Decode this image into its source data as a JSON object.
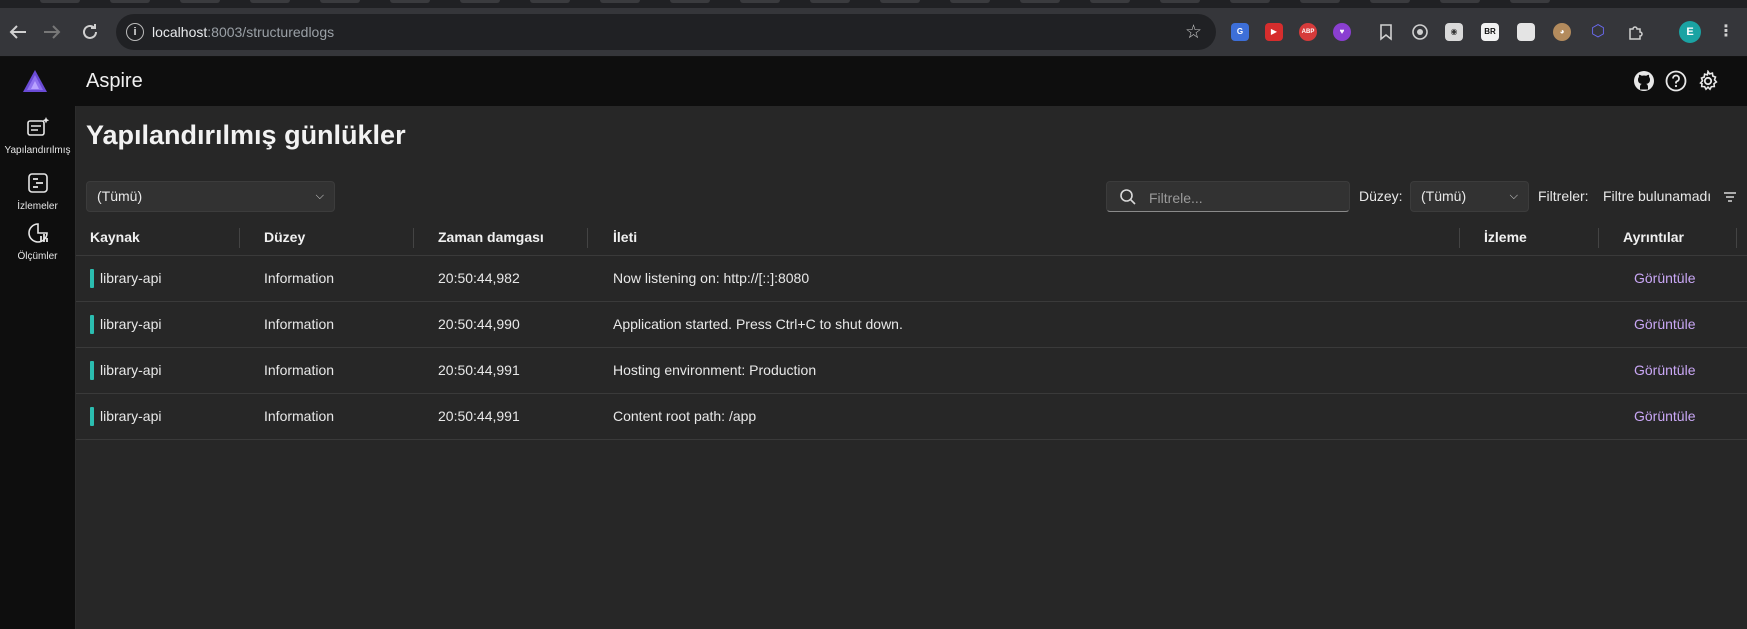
{
  "browser": {
    "url_host": "localhost",
    "url_rest": ":8003/structuredlogs",
    "extensions": [
      {
        "name": "translate-ext-icon",
        "label": "G",
        "color": "#3d6fd8"
      },
      {
        "name": "video-ext-icon",
        "label": "▶",
        "color": "#d62d2d"
      },
      {
        "name": "adblock-ext-icon",
        "label": "ABP",
        "color": "#d63b3b"
      },
      {
        "name": "heart-ext-icon",
        "label": "♥",
        "color": "#8a3fd1"
      },
      {
        "name": "bookmark-ext-icon",
        "label": "",
        "color": "transparent"
      },
      {
        "name": "record-ext-icon",
        "label": "◎",
        "color": "transparent"
      },
      {
        "name": "camera-ext-icon",
        "label": "◉",
        "color": "#d9d9d9"
      },
      {
        "name": "br-ext-icon",
        "label": "BR",
        "color": "#f2f2f2"
      },
      {
        "name": "note-ext-icon",
        "label": "",
        "color": "#e4e4e4"
      },
      {
        "name": "glasses-ext-icon",
        "label": "◕",
        "color": "#b38b5d"
      },
      {
        "name": "cube-ext-icon",
        "label": "⬡",
        "color": "#4a4ae0"
      },
      {
        "name": "puzzle-ext-icon",
        "label": "",
        "color": "transparent"
      }
    ],
    "profile_initial": "E"
  },
  "app": {
    "title": "Aspire"
  },
  "sidebar": {
    "items": [
      {
        "label": "Yapılandırılmış"
      },
      {
        "label": "İzlemeler"
      },
      {
        "label": "Ölçümler"
      }
    ]
  },
  "page": {
    "title": "Yapılandırılmış günlükler",
    "resource_select": "(Tümü)",
    "search_placeholder": "Filtrele...",
    "level_label": "Düzey:",
    "level_select": "(Tümü)",
    "filters_label": "Filtreler:",
    "filters_value": "Filtre bulunamadı"
  },
  "grid": {
    "headers": [
      "Kaynak",
      "Düzey",
      "Zaman damgası",
      "İleti",
      "İzleme",
      "Ayrıntılar"
    ],
    "rows": [
      {
        "source": "library-api",
        "level": "Information",
        "timestamp": "20:50:44,982",
        "message": "Now listening on: http://[::]:8080",
        "trace": "",
        "details": "Görüntüle"
      },
      {
        "source": "library-api",
        "level": "Information",
        "timestamp": "20:50:44,990",
        "message": "Application started. Press Ctrl+C to shut down.",
        "trace": "",
        "details": "Görüntüle"
      },
      {
        "source": "library-api",
        "level": "Information",
        "timestamp": "20:50:44,991",
        "message": "Hosting environment: Production",
        "trace": "",
        "details": "Görüntüle"
      },
      {
        "source": "library-api",
        "level": "Information",
        "timestamp": "20:50:44,991",
        "message": "Content root path: /app",
        "trace": "",
        "details": "Görüntüle"
      }
    ]
  },
  "colors": {
    "accent": "#c9a7f5",
    "resource_bar": "#2bbdb0"
  }
}
